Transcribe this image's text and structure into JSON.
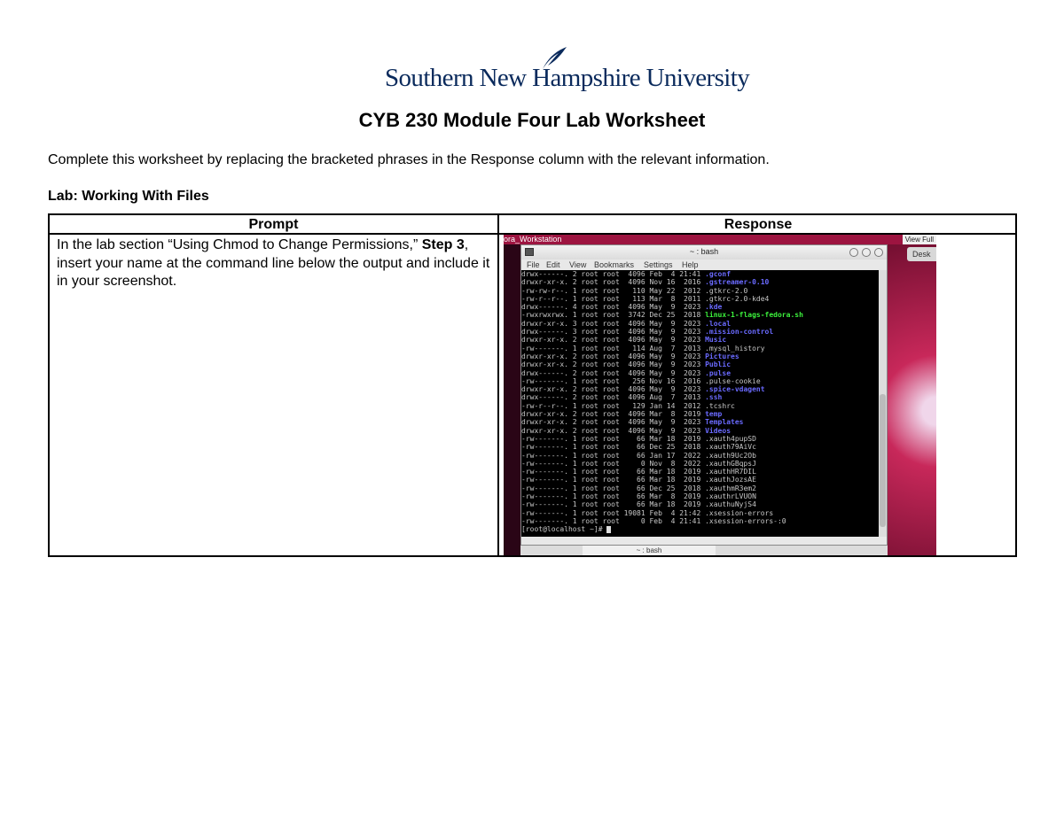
{
  "header": {
    "logo_text": "Southern New Hampshire University",
    "title": "CYB 230 Module Four Lab Worksheet"
  },
  "instructions": "Complete this worksheet by replacing the bracketed phrases in the Response column with the relevant information.",
  "section_title": "Lab: Working With Files",
  "table": {
    "col_prompt": "Prompt",
    "col_response": "Response",
    "row": {
      "prompt_before": "In the lab section “Using Chmod to Change Permissions,” ",
      "prompt_bold": "Step 3",
      "prompt_after": ", insert your name at the command line below the output and include it in your screenshot."
    }
  },
  "screenshot": {
    "workstation_label": "ora_Workstation",
    "view_full": "View Full",
    "desktop_label": "Desk",
    "window_title": "~ : bash",
    "menu": [
      "File",
      "Edit",
      "View",
      "Bookmarks",
      "Settings",
      "Help"
    ],
    "taskbar_item": "~ : bash",
    "prompt": "[root@localhost ~]# ",
    "listing": [
      {
        "perm": "drwx------.",
        "links": "2",
        "size": "4096",
        "date": "Feb  4 21:41",
        "name": ".gconf",
        "kind": "dir"
      },
      {
        "perm": "drwxr-xr-x.",
        "links": "2",
        "size": "4096",
        "date": "Nov 16  2016",
        "name": ".gstreamer-0.10",
        "kind": "dir"
      },
      {
        "perm": "-rw-rw-r--.",
        "links": "1",
        "size": "110",
        "date": "May 22  2012",
        "name": ".gtkrc-2.0",
        "kind": "file"
      },
      {
        "perm": "-rw-r--r--.",
        "links": "1",
        "size": "113",
        "date": "Mar  8  2011",
        "name": ".gtkrc-2.0-kde4",
        "kind": "file"
      },
      {
        "perm": "drwx------.",
        "links": "4",
        "size": "4096",
        "date": "May  9  2023",
        "name": ".kde",
        "kind": "dir"
      },
      {
        "perm": "-rwxrwxrwx.",
        "links": "1",
        "size": "3742",
        "date": "Dec 25  2018",
        "name": "linux-1-flags-fedora.sh",
        "kind": "exe"
      },
      {
        "perm": "drwxr-xr-x.",
        "links": "3",
        "size": "4096",
        "date": "May  9  2023",
        "name": ".local",
        "kind": "dir"
      },
      {
        "perm": "drwx------.",
        "links": "3",
        "size": "4096",
        "date": "May  9  2023",
        "name": ".mission-control",
        "kind": "dir"
      },
      {
        "perm": "drwxr-xr-x.",
        "links": "2",
        "size": "4096",
        "date": "May  9  2023",
        "name": "Music",
        "kind": "dir"
      },
      {
        "perm": "-rw-------.",
        "links": "1",
        "size": "114",
        "date": "Aug  7  2013",
        "name": ".mysql_history",
        "kind": "file"
      },
      {
        "perm": "drwxr-xr-x.",
        "links": "2",
        "size": "4096",
        "date": "May  9  2023",
        "name": "Pictures",
        "kind": "dir"
      },
      {
        "perm": "drwxr-xr-x.",
        "links": "2",
        "size": "4096",
        "date": "May  9  2023",
        "name": "Public",
        "kind": "dir"
      },
      {
        "perm": "drwx------.",
        "links": "2",
        "size": "4096",
        "date": "May  9  2023",
        "name": ".pulse",
        "kind": "dir"
      },
      {
        "perm": "-rw-------.",
        "links": "1",
        "size": "256",
        "date": "Nov 16  2016",
        "name": ".pulse-cookie",
        "kind": "file"
      },
      {
        "perm": "drwxr-xr-x.",
        "links": "2",
        "size": "4096",
        "date": "May  9  2023",
        "name": ".spice-vdagent",
        "kind": "dir"
      },
      {
        "perm": "drwx------.",
        "links": "2",
        "size": "4096",
        "date": "Aug  7  2013",
        "name": ".ssh",
        "kind": "dir"
      },
      {
        "perm": "-rw-r--r--.",
        "links": "1",
        "size": "129",
        "date": "Jan 14  2012",
        "name": ".tcshrc",
        "kind": "file"
      },
      {
        "perm": "drwxr-xr-x.",
        "links": "2",
        "size": "4096",
        "date": "Mar  8  2019",
        "name": "temp",
        "kind": "dir"
      },
      {
        "perm": "drwxr-xr-x.",
        "links": "2",
        "size": "4096",
        "date": "May  9  2023",
        "name": "Templates",
        "kind": "dir"
      },
      {
        "perm": "drwxr-xr-x.",
        "links": "2",
        "size": "4096",
        "date": "May  9  2023",
        "name": "Videos",
        "kind": "dir"
      },
      {
        "perm": "-rw-------.",
        "links": "1",
        "size": "66",
        "date": "Mar 18  2019",
        "name": ".xauth4pupSD",
        "kind": "file"
      },
      {
        "perm": "-rw-------.",
        "links": "1",
        "size": "66",
        "date": "Dec 25  2018",
        "name": ".xauth79AiVc",
        "kind": "file"
      },
      {
        "perm": "-rw-------.",
        "links": "1",
        "size": "66",
        "date": "Jan 17  2022",
        "name": ".xauth9Uc2Ob",
        "kind": "file"
      },
      {
        "perm": "-rw-------.",
        "links": "1",
        "size": "0",
        "date": "Nov  8  2022",
        "name": ".xauthGBqpsJ",
        "kind": "file"
      },
      {
        "perm": "-rw-------.",
        "links": "1",
        "size": "66",
        "date": "Mar 18  2019",
        "name": ".xauthHR7DIL",
        "kind": "file"
      },
      {
        "perm": "-rw-------.",
        "links": "1",
        "size": "66",
        "date": "Mar 18  2019",
        "name": ".xauthJozsAE",
        "kind": "file"
      },
      {
        "perm": "-rw-------.",
        "links": "1",
        "size": "66",
        "date": "Dec 25  2018",
        "name": ".xauthmR3em2",
        "kind": "file"
      },
      {
        "perm": "-rw-------.",
        "links": "1",
        "size": "66",
        "date": "Mar  8  2019",
        "name": ".xauthrLVUON",
        "kind": "file"
      },
      {
        "perm": "-rw-------.",
        "links": "1",
        "size": "66",
        "date": "Mar 18  2019",
        "name": ".xauthuNyjS4",
        "kind": "file"
      },
      {
        "perm": "-rw-------.",
        "links": "1",
        "size": "19081",
        "date": "Feb  4 21:42",
        "name": ".xsession-errors",
        "kind": "file"
      },
      {
        "perm": "-rw-------.",
        "links": "1",
        "size": "0",
        "date": "Feb  4 21:41",
        "name": ".xsession-errors-:0",
        "kind": "file"
      }
    ]
  },
  "colors": {
    "logo_blue": "#0a2a5c",
    "dir": "#6a6aff",
    "exe": "#3cf03c",
    "terminal_bg": "#000000",
    "fedora_bar": "#9d1440"
  }
}
